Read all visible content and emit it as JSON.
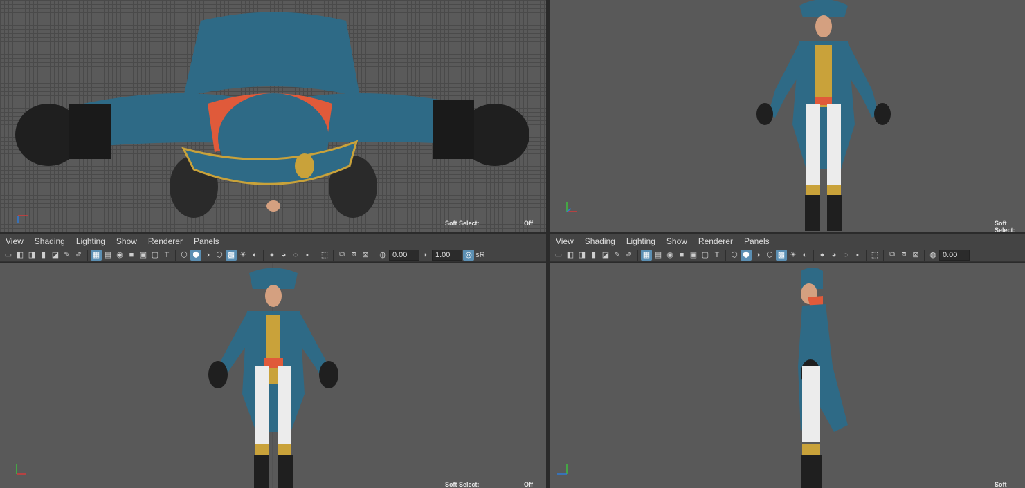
{
  "menus": [
    "View",
    "Shading",
    "Lighting",
    "Show",
    "Renderer",
    "Panels"
  ],
  "toolbar": {
    "exposure_value": "0.00",
    "gamma_value": "1.00",
    "srgb_label": "sR"
  },
  "soft_select": {
    "label": "Soft Select:",
    "value": "Off"
  },
  "axis": {
    "x": "x",
    "y": "y",
    "z": "z"
  },
  "colors": {
    "coat": "#2e6a86",
    "lapel_red": "#e05a3a",
    "gold": "#c9a23a",
    "trouser": "#ececec",
    "glove": "#1f1f1f",
    "highlight": "#5b8fb3"
  }
}
